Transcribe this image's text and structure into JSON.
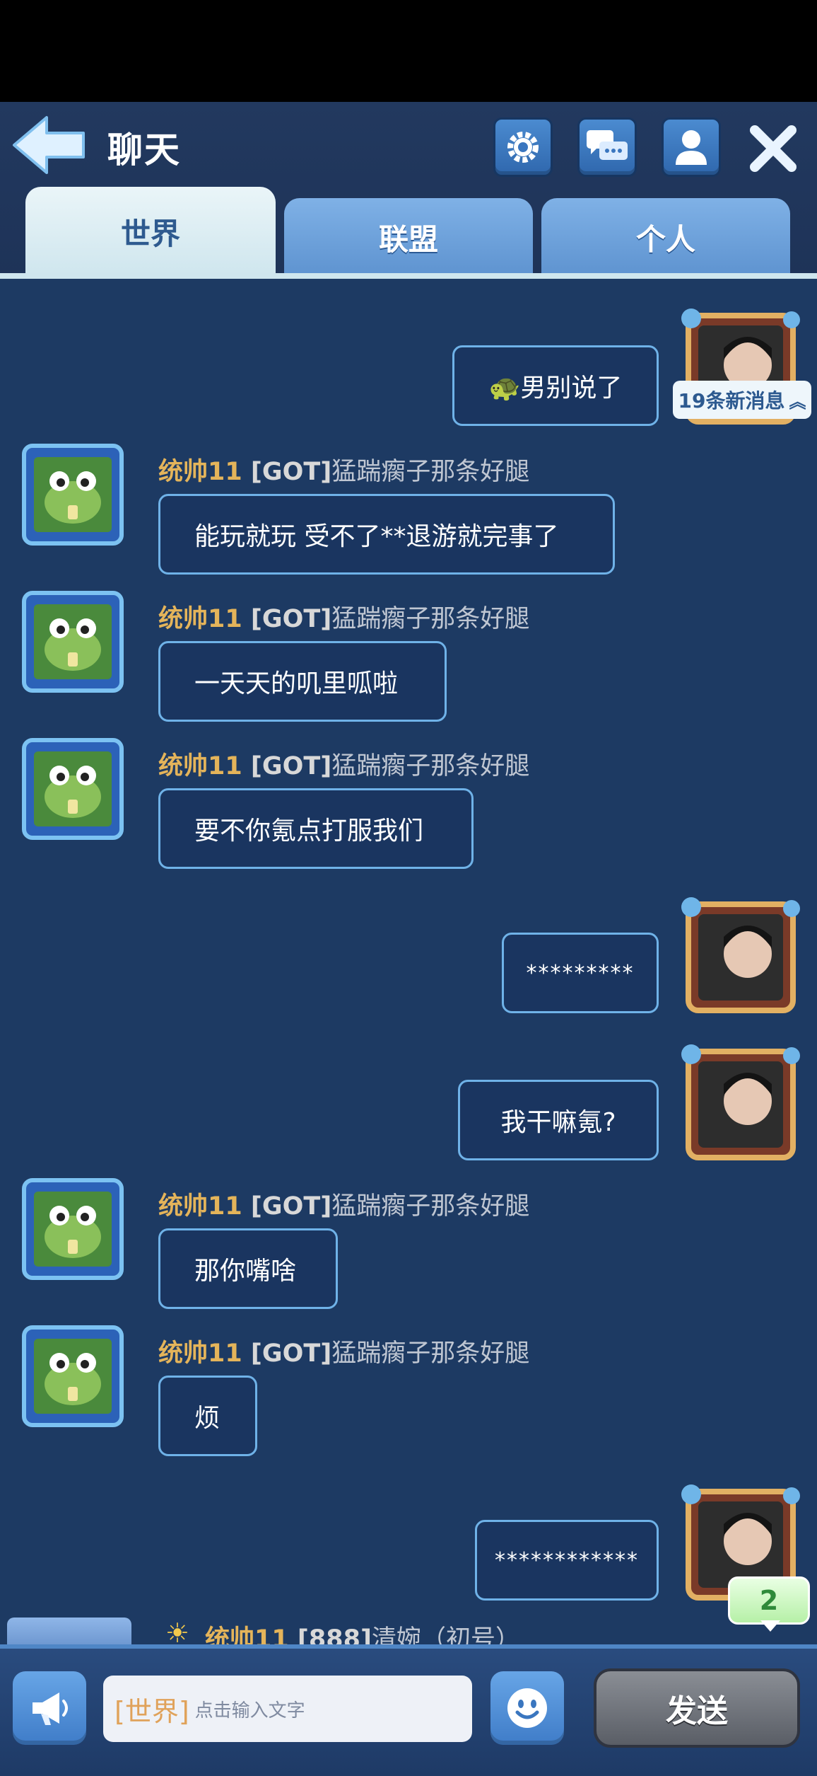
{
  "header": {
    "title": "聊天",
    "buttons": [
      "settings-gear-icon",
      "chat-bubbles-icon",
      "profile-icon",
      "close-icon"
    ]
  },
  "tabs": [
    {
      "label": "世界",
      "active": true
    },
    {
      "label": "联盟",
      "active": false
    },
    {
      "label": "个人",
      "active": false
    }
  ],
  "new_messages": "19条新消息",
  "messages": [
    {
      "side": "right",
      "text": "🐢男别说了"
    },
    {
      "side": "left",
      "rank": "统帅11",
      "tag": "[GOT]",
      "nick": "猛踹瘸子那条好腿",
      "text": "能玩就玩  受不了**退游就完事了"
    },
    {
      "side": "left",
      "rank": "统帅11",
      "tag": "[GOT]",
      "nick": "猛踹瘸子那条好腿",
      "text": "一天天的叽里呱啦"
    },
    {
      "side": "left",
      "rank": "统帅11",
      "tag": "[GOT]",
      "nick": "猛踹瘸子那条好腿",
      "text": "要不你氪点打服我们"
    },
    {
      "side": "right",
      "text": "*********"
    },
    {
      "side": "right",
      "text": "我干嘛氪?"
    },
    {
      "side": "left",
      "rank": "统帅11",
      "tag": "[GOT]",
      "nick": "猛踹瘸子那条好腿",
      "text": "那你嘴啥"
    },
    {
      "side": "left",
      "rank": "统帅11",
      "tag": "[GOT]",
      "nick": "猛踹瘸子那条好腿",
      "text": "烦"
    },
    {
      "side": "right",
      "text": "************"
    }
  ],
  "partial_message": {
    "rank": "统帅11",
    "tag": "[888]",
    "nick": "清婉（初号）"
  },
  "unread_badge": "2",
  "footer": {
    "channel_label": "[世界]",
    "input_placeholder": "点击输入文字",
    "send_label": "发送"
  },
  "colors": {
    "chat_bg": "#1d3a63",
    "bubble_border": "#6fb2e8",
    "rank_gold": "#e4b45a",
    "tab_active": "#cfe6ee",
    "tab_inactive": "#6a9fdb"
  }
}
